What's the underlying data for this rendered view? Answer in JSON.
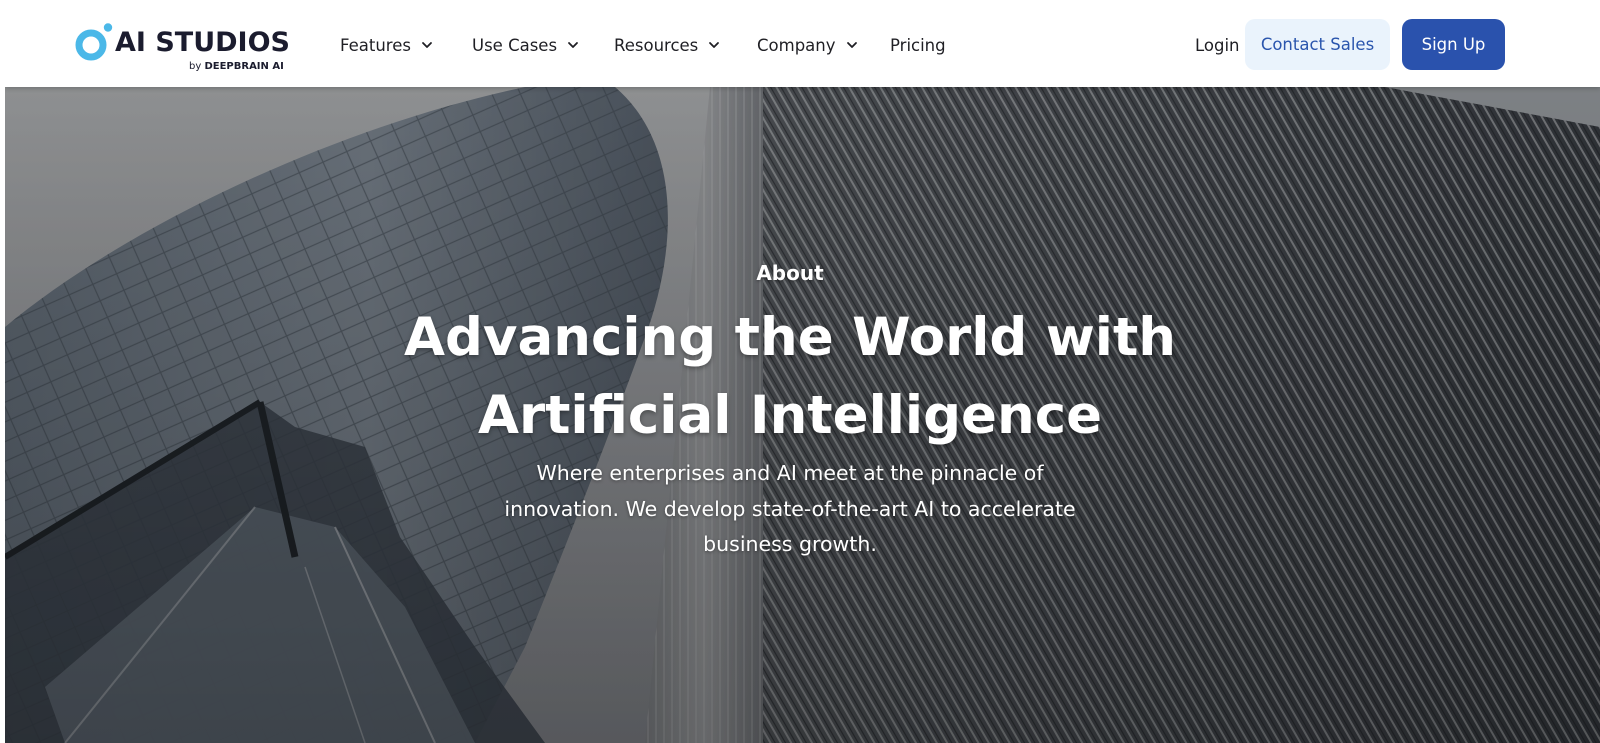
{
  "brand": {
    "name": "AI STUDIOS",
    "by": "by",
    "company": "DEEPBRAIN AI",
    "colors": {
      "logo_ring": "#4bb8e8",
      "text": "#1b1c2e"
    }
  },
  "nav": {
    "items": [
      {
        "label": "Features",
        "has_dropdown": true
      },
      {
        "label": "Use Cases",
        "has_dropdown": true
      },
      {
        "label": "Resources",
        "has_dropdown": true
      },
      {
        "label": "Company",
        "has_dropdown": true
      },
      {
        "label": "Pricing",
        "has_dropdown": false
      }
    ]
  },
  "actions": {
    "login": "Login",
    "contact_sales": "Contact Sales",
    "sign_up": "Sign Up",
    "colors": {
      "primary": "#2a52ad",
      "secondary_bg": "#eaf3fc",
      "secondary_text": "#2a55ad"
    }
  },
  "hero": {
    "eyebrow": "About",
    "title_line1": "Advancing the World with",
    "title_line2": "Artificial Intelligence",
    "subtitle_line1": "Where enterprises and AI meet at the pinnacle of",
    "subtitle_line2": "innovation. We develop state-of-the-art AI to accelerate",
    "subtitle_line3": "business growth.",
    "background": "skyscrapers-photo"
  }
}
